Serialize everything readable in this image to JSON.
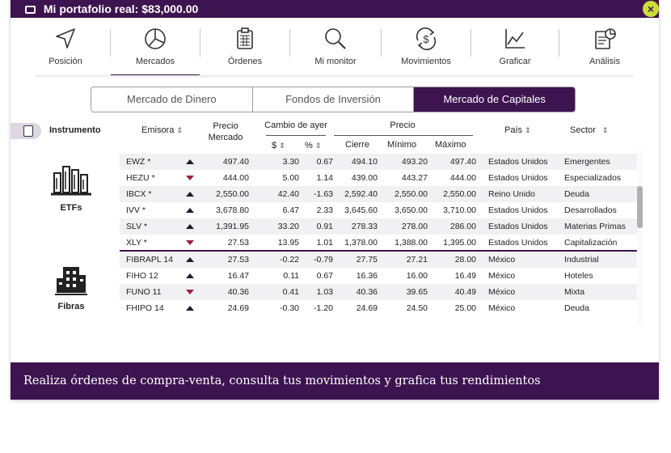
{
  "titlebar": {
    "title": "Mi portafolio real: $83,000.00",
    "close": "×"
  },
  "toolbar": {
    "items": [
      {
        "label": "Posición",
        "icon": "navigation-arrow-icon"
      },
      {
        "label": "Mercados",
        "icon": "pie-chart-icon",
        "active": true
      },
      {
        "label": "Órdenes",
        "icon": "clipboard-icon"
      },
      {
        "label": "Mi monitor",
        "icon": "magnifier-icon"
      },
      {
        "label": "Movimientos",
        "icon": "dollar-cycle-icon"
      },
      {
        "label": "Graficar",
        "icon": "line-chart-icon"
      },
      {
        "label": "Análisis",
        "icon": "report-chart-icon"
      }
    ]
  },
  "tabs": [
    {
      "label": "Mercado de Dinero"
    },
    {
      "label": "Fondos de Inversión"
    },
    {
      "label": "Mercado de Capitales",
      "active": true
    }
  ],
  "table": {
    "headers": {
      "instrumento": "Instrumento",
      "emisora": "Emisora",
      "precio_mercado_1": "Precio",
      "precio_mercado_2": "Mercado",
      "cambio": "Cambio de ayer",
      "cambio_usd": "$",
      "cambio_pct": "%",
      "precio": "Precio",
      "cierre": "Cierre",
      "minimo": "Mínimo",
      "maximo": "Máximo",
      "pais": "País",
      "sector": "Sector"
    },
    "sort_icon": "⇕",
    "groups": [
      {
        "label": "ETFs",
        "icon": "etf-buildings-icon"
      },
      {
        "label": "Fibras",
        "icon": "fibra-building-icon"
      }
    ],
    "rows": [
      {
        "emisora": "EWZ *",
        "dir": "up",
        "precio": "497.40",
        "cambio": "3.30",
        "pct": "0.67",
        "cierre": "494.10",
        "minimo": "493.20",
        "maximo": "497.40",
        "pais": "Estados Unidos",
        "sector": "Emergentes"
      },
      {
        "emisora": "HEZU *",
        "dir": "down",
        "precio": "444.00",
        "cambio": "5.00",
        "pct": "1.14",
        "cierre": "439.00",
        "minimo": "443.27",
        "maximo": "444.00",
        "pais": "Estados Unidos",
        "sector": "Especializados"
      },
      {
        "emisora": "IBCX *",
        "dir": "up",
        "precio": "2,550.00",
        "cambio": "42.40",
        "pct": "-1.63",
        "cierre": "2,592.40",
        "minimo": "2,550.00",
        "maximo": "2,550.00",
        "pais": "Reino Unido",
        "sector": "Deuda"
      },
      {
        "emisora": "IVV *",
        "dir": "up",
        "precio": "3,678.80",
        "cambio": "6.47",
        "pct": "2.33",
        "cierre": "3,645.60",
        "minimo": "3,650.00",
        "maximo": "3,710.00",
        "pais": "Estados Unidos",
        "sector": "Desarrollados"
      },
      {
        "emisora": "SLV *",
        "dir": "up",
        "precio": "1,391.95",
        "cambio": "33.20",
        "pct": "0.91",
        "cierre": "278.33",
        "minimo": "278.00",
        "maximo": "286.00",
        "pais": "Estados Unidos",
        "sector": "Materias Primas"
      },
      {
        "emisora": "XLY *",
        "dir": "down",
        "precio": "27.53",
        "cambio": "13.95",
        "pct": "1.01",
        "cierre": "1,378.00",
        "minimo": "1,388.00",
        "maximo": "1,395.00",
        "pais": "Estados Unidos",
        "sector": "Capitalización"
      },
      {
        "emisora": "FIBRAPL 14",
        "dir": "up",
        "precio": "27.53",
        "cambio": "-0.22",
        "pct": "-0.79",
        "cierre": "27.75",
        "minimo": "27.21",
        "maximo": "28.00",
        "pais": "México",
        "sector": "Industrial"
      },
      {
        "emisora": "FIHO 12",
        "dir": "up",
        "precio": "16.47",
        "cambio": "0.11",
        "pct": "0.67",
        "cierre": "16.36",
        "minimo": "16.00",
        "maximo": "16.49",
        "pais": "México",
        "sector": "Hoteles"
      },
      {
        "emisora": "FUNO 11",
        "dir": "down",
        "precio": "40.36",
        "cambio": "0.41",
        "pct": "1.03",
        "cierre": "40.36",
        "minimo": "39.65",
        "maximo": "40.49",
        "pais": "México",
        "sector": "Mixta"
      },
      {
        "emisora": "FHIPO 14",
        "dir": "up",
        "precio": "24.69",
        "cambio": "-0.30",
        "pct": "-1.20",
        "cierre": "24.69",
        "minimo": "24.50",
        "maximo": "25.00",
        "pais": "México",
        "sector": "Deuda"
      }
    ]
  },
  "footer": {
    "text": "Realiza órdenes de compra-venta, consulta tus movimientos y grafica tus rendimientos"
  },
  "colors": {
    "brand": "#3d1450",
    "accent": "#cadd3a",
    "down": "#a31d3b",
    "up": "#1d1d2e"
  }
}
